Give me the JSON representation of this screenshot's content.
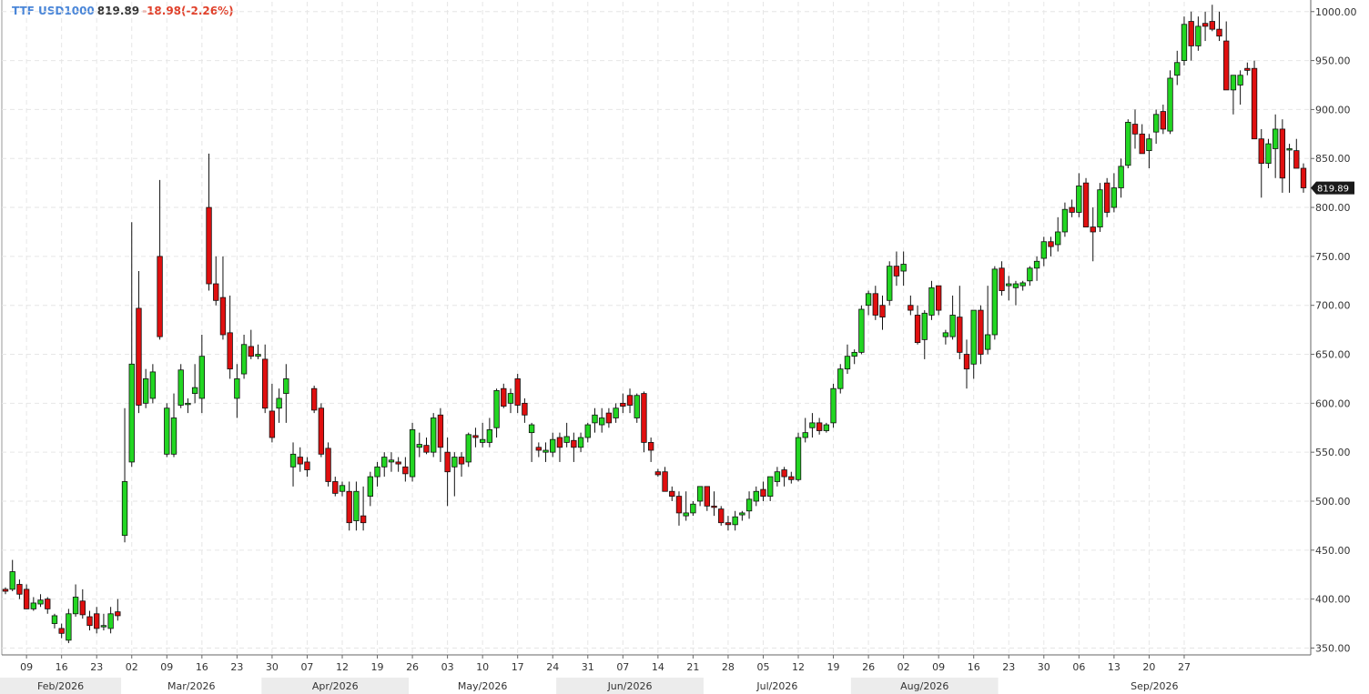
{
  "header": {
    "symbol": "TTF USD1000",
    "last_price": "819.89",
    "change": "-18.98(-2.26%)"
  },
  "colors": {
    "up": "#22d622",
    "down": "#e00f0f",
    "grid": "#e6e6e6",
    "symbol": "#4a86d8",
    "change": "#e0402a",
    "month_band": "#ececec"
  },
  "chart_data": {
    "type": "candlestick",
    "title": "TTF USD1000",
    "ylim": [
      343,
      1010
    ],
    "y_ticks": [
      "1000.00",
      "950.00",
      "900.00",
      "850.00",
      "800.00",
      "750.00",
      "700.00",
      "650.00",
      "600.00",
      "550.00",
      "500.00",
      "450.00",
      "400.00",
      "350.00"
    ],
    "x_ticks": [
      "09",
      "16",
      "23",
      "02",
      "09",
      "16",
      "23",
      "30",
      "07",
      "12",
      "19",
      "26",
      "03",
      "10",
      "17",
      "24",
      "31",
      "07",
      "14",
      "21",
      "28",
      "05",
      "12",
      "19",
      "26",
      "02",
      "09",
      "16",
      "23",
      "30",
      "06",
      "13",
      "20",
      "27"
    ],
    "months": [
      "Feb/2026",
      "Mar/2026",
      "Apr/2026",
      "May/2026",
      "Jun/2026",
      "Jul/2026",
      "Aug/2026",
      "Sep/2026"
    ],
    "last_value": "819.89",
    "grid": true,
    "series": [
      {
        "values": [
          [
            410,
            412,
            405,
            408
          ],
          [
            410,
            440,
            408,
            428
          ],
          [
            415,
            420,
            400,
            405
          ],
          [
            410,
            415,
            390,
            390
          ],
          [
            390,
            402,
            388,
            396
          ],
          [
            395,
            405,
            392,
            399
          ],
          [
            400,
            402,
            385,
            390
          ],
          [
            375,
            385,
            370,
            383
          ],
          [
            370,
            375,
            360,
            365
          ],
          [
            358,
            390,
            355,
            385
          ],
          [
            385,
            415,
            382,
            402
          ],
          [
            398,
            410,
            380,
            384
          ],
          [
            382,
            388,
            368,
            373
          ],
          [
            385,
            392,
            365,
            370
          ],
          [
            372,
            385,
            368,
            373
          ],
          [
            370,
            392,
            365,
            385
          ],
          [
            387,
            400,
            378,
            383
          ],
          [
            465,
            595,
            458,
            520
          ],
          [
            540,
            785,
            535,
            640
          ],
          [
            697,
            735,
            590,
            598
          ],
          [
            600,
            635,
            595,
            625
          ],
          [
            605,
            640,
            600,
            632
          ],
          [
            750,
            828,
            665,
            668
          ],
          [
            548,
            600,
            545,
            595
          ],
          [
            548,
            610,
            545,
            585
          ],
          [
            598,
            640,
            595,
            634
          ],
          [
            599,
            605,
            590,
            600
          ],
          [
            610,
            640,
            600,
            616
          ],
          [
            605,
            670,
            590,
            648
          ],
          [
            800,
            855,
            715,
            722
          ],
          [
            722,
            750,
            700,
            705
          ],
          [
            708,
            750,
            665,
            670
          ],
          [
            672,
            710,
            625,
            635
          ],
          [
            605,
            640,
            585,
            625
          ],
          [
            630,
            670,
            625,
            660
          ],
          [
            658,
            675,
            645,
            648
          ],
          [
            648,
            660,
            645,
            650
          ],
          [
            645,
            660,
            590,
            595
          ],
          [
            592,
            620,
            560,
            565
          ],
          [
            595,
            615,
            580,
            605
          ],
          [
            610,
            640,
            580,
            625
          ],
          [
            535,
            560,
            515,
            548
          ],
          [
            545,
            555,
            530,
            538
          ],
          [
            540,
            545,
            525,
            532
          ],
          [
            615,
            618,
            590,
            593
          ],
          [
            595,
            600,
            545,
            548
          ],
          [
            554,
            560,
            515,
            520
          ],
          [
            520,
            525,
            505,
            508
          ],
          [
            510,
            520,
            505,
            516
          ],
          [
            510,
            520,
            470,
            478
          ],
          [
            480,
            520,
            470,
            510
          ],
          [
            485,
            515,
            470,
            478
          ],
          [
            505,
            530,
            495,
            525
          ],
          [
            525,
            540,
            515,
            535
          ],
          [
            535,
            550,
            525,
            545
          ],
          [
            540,
            550,
            530,
            542
          ],
          [
            540,
            545,
            530,
            538
          ],
          [
            535,
            545,
            520,
            528
          ],
          [
            525,
            580,
            520,
            573
          ],
          [
            555,
            570,
            545,
            558
          ],
          [
            557,
            565,
            548,
            550
          ],
          [
            550,
            590,
            545,
            585
          ],
          [
            588,
            595,
            540,
            555
          ],
          [
            550,
            565,
            495,
            530
          ],
          [
            535,
            550,
            505,
            545
          ],
          [
            545,
            550,
            525,
            538
          ],
          [
            540,
            570,
            535,
            568
          ],
          [
            567,
            575,
            555,
            565
          ],
          [
            560,
            580,
            555,
            563
          ],
          [
            560,
            585,
            555,
            573
          ],
          [
            575,
            615,
            565,
            613
          ],
          [
            615,
            620,
            595,
            597
          ],
          [
            600,
            615,
            590,
            610
          ],
          [
            625,
            630,
            590,
            598
          ],
          [
            600,
            605,
            580,
            588
          ],
          [
            570,
            580,
            540,
            578
          ],
          [
            555,
            560,
            545,
            552
          ],
          [
            550,
            560,
            540,
            552
          ],
          [
            550,
            570,
            545,
            563
          ],
          [
            565,
            570,
            540,
            555
          ],
          [
            560,
            580,
            555,
            566
          ],
          [
            562,
            570,
            540,
            555
          ],
          [
            555,
            570,
            550,
            565
          ],
          [
            565,
            580,
            560,
            578
          ],
          [
            580,
            595,
            570,
            588
          ],
          [
            578,
            595,
            570,
            585
          ],
          [
            590,
            595,
            575,
            580
          ],
          [
            585,
            600,
            580,
            595
          ],
          [
            600,
            610,
            590,
            597
          ],
          [
            608,
            615,
            590,
            598
          ],
          [
            585,
            610,
            580,
            608
          ],
          [
            610,
            612,
            550,
            560
          ],
          [
            560,
            565,
            540,
            552
          ],
          [
            530,
            533,
            525,
            527
          ],
          [
            530,
            535,
            515,
            510
          ],
          [
            510,
            515,
            500,
            505
          ],
          [
            505,
            510,
            475,
            488
          ],
          [
            485,
            510,
            480,
            488
          ],
          [
            488,
            500,
            485,
            497
          ],
          [
            500,
            515,
            495,
            515
          ],
          [
            515,
            515,
            490,
            495
          ],
          [
            495,
            510,
            485,
            494
          ],
          [
            492,
            495,
            475,
            478
          ],
          [
            478,
            485,
            470,
            476
          ],
          [
            476,
            490,
            470,
            484
          ],
          [
            486,
            490,
            480,
            488
          ],
          [
            490,
            510,
            482,
            502
          ],
          [
            500,
            515,
            495,
            510
          ],
          [
            512,
            520,
            500,
            505
          ],
          [
            505,
            525,
            500,
            525
          ],
          [
            520,
            535,
            515,
            530
          ],
          [
            532,
            535,
            515,
            525
          ],
          [
            525,
            530,
            518,
            522
          ],
          [
            522,
            570,
            520,
            565
          ],
          [
            565,
            585,
            560,
            570
          ],
          [
            575,
            590,
            565,
            580
          ],
          [
            580,
            585,
            568,
            572
          ],
          [
            572,
            580,
            570,
            578
          ],
          [
            580,
            620,
            575,
            615
          ],
          [
            615,
            640,
            610,
            635
          ],
          [
            635,
            660,
            630,
            648
          ],
          [
            648,
            655,
            640,
            652
          ],
          [
            652,
            700,
            650,
            696
          ],
          [
            700,
            715,
            690,
            712
          ],
          [
            712,
            720,
            685,
            690
          ],
          [
            700,
            710,
            675,
            688
          ],
          [
            705,
            745,
            700,
            740
          ],
          [
            740,
            755,
            720,
            730
          ],
          [
            735,
            755,
            720,
            742
          ],
          [
            700,
            710,
            690,
            695
          ],
          [
            690,
            700,
            660,
            662
          ],
          [
            665,
            695,
            645,
            692
          ],
          [
            690,
            725,
            685,
            718
          ],
          [
            720,
            720,
            690,
            695
          ],
          [
            668,
            675,
            660,
            672
          ],
          [
            668,
            710,
            665,
            690
          ],
          [
            688,
            720,
            645,
            652
          ],
          [
            650,
            665,
            615,
            635
          ],
          [
            640,
            665,
            625,
            695
          ],
          [
            695,
            700,
            640,
            650
          ],
          [
            655,
            720,
            650,
            670
          ],
          [
            670,
            740,
            665,
            737
          ],
          [
            738,
            745,
            710,
            715
          ],
          [
            720,
            730,
            705,
            722
          ],
          [
            718,
            725,
            700,
            722
          ],
          [
            720,
            725,
            715,
            723
          ],
          [
            725,
            740,
            720,
            738
          ],
          [
            738,
            750,
            725,
            745
          ],
          [
            748,
            770,
            740,
            765
          ],
          [
            765,
            770,
            750,
            760
          ],
          [
            762,
            790,
            755,
            775
          ],
          [
            775,
            805,
            770,
            798
          ],
          [
            800,
            808,
            790,
            795
          ],
          [
            795,
            835,
            790,
            822
          ],
          [
            825,
            830,
            780,
            780
          ],
          [
            780,
            800,
            745,
            775
          ],
          [
            780,
            825,
            775,
            818
          ],
          [
            825,
            830,
            790,
            795
          ],
          [
            800,
            835,
            795,
            820
          ],
          [
            820,
            850,
            810,
            842
          ],
          [
            843,
            890,
            840,
            887
          ],
          [
            885,
            900,
            860,
            875
          ],
          [
            875,
            885,
            860,
            855
          ],
          [
            858,
            875,
            840,
            870
          ],
          [
            877,
            900,
            865,
            895
          ],
          [
            898,
            905,
            875,
            880
          ],
          [
            878,
            940,
            875,
            932
          ],
          [
            935,
            960,
            925,
            948
          ],
          [
            950,
            995,
            945,
            987
          ],
          [
            990,
            1000,
            950,
            965
          ],
          [
            965,
            995,
            960,
            985
          ],
          [
            988,
            1000,
            970,
            985
          ],
          [
            990,
            1007,
            980,
            982
          ],
          [
            982,
            1000,
            970,
            975
          ],
          [
            970,
            990,
            920,
            920
          ],
          [
            920,
            935,
            895,
            935
          ],
          [
            925,
            940,
            905,
            935
          ],
          [
            942,
            948,
            935,
            940
          ],
          [
            942,
            950,
            870,
            870
          ],
          [
            870,
            880,
            810,
            845
          ],
          [
            845,
            870,
            840,
            865
          ],
          [
            860,
            895,
            830,
            880
          ],
          [
            880,
            890,
            815,
            830
          ],
          [
            860,
            865,
            815,
            860
          ],
          [
            858,
            870,
            840,
            840
          ],
          [
            840,
            845,
            815,
            820
          ]
        ]
      }
    ]
  }
}
